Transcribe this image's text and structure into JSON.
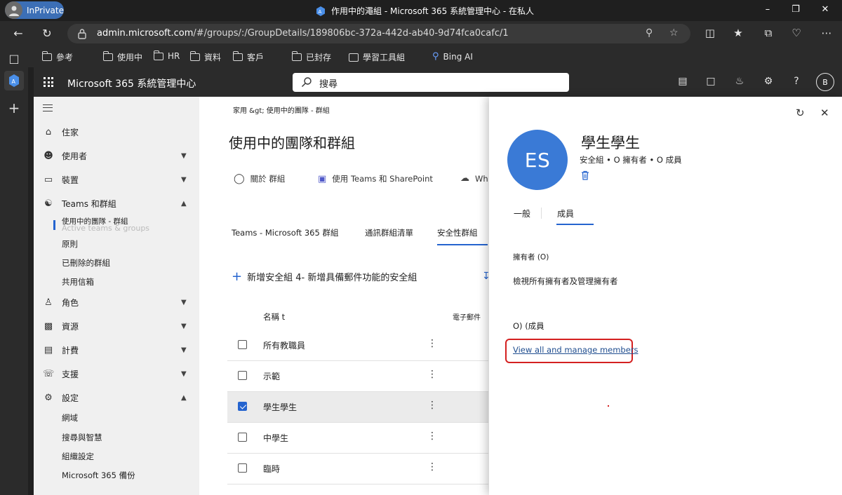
{
  "browser": {
    "inprivate_label": "InPrivate",
    "window_title": "作用中的澠組 - Microsoft 365 系統管理中心 - 在私人",
    "url_host": "admin.microsoft.com",
    "url_path": "/#/groups/:/GroupDetails/189806bc-372a-442d-ab40-9d74fca0cafc/1",
    "favorites": [
      {
        "label": "參考",
        "icon": "folder-icon"
      },
      {
        "label": "使用中",
        "icon": "folder-icon"
      },
      {
        "label": "HR",
        "icon": "folder-icon"
      },
      {
        "label": "資料",
        "icon": "folder-icon"
      },
      {
        "label": "客戶",
        "icon": "folder-icon"
      },
      {
        "label": "已封存",
        "icon": "folder-icon"
      },
      {
        "label": "學習工具組",
        "icon": "app-icon"
      },
      {
        "label": "Bing AI",
        "icon": "search-icon"
      }
    ]
  },
  "header": {
    "app_title": "Microsoft 365 系統管理中心",
    "search_placeholder": "搜尋",
    "user_initial": "B"
  },
  "nav": {
    "items": [
      {
        "label": "住家",
        "icon": "home-icon"
      },
      {
        "label": "使用者",
        "icon": "user-icon"
      },
      {
        "label": "裝置",
        "icon": "device-icon"
      },
      {
        "label": "Teams 和群組",
        "icon": "teams-icon"
      },
      {
        "label": "角色",
        "icon": "role-icon"
      },
      {
        "label": "資源",
        "icon": "resource-icon"
      },
      {
        "label": "計費",
        "icon": "billing-icon"
      },
      {
        "label": "支援",
        "icon": "support-icon"
      },
      {
        "label": "設定",
        "icon": "settings-icon"
      }
    ],
    "teams_sub": [
      "使用中的團隊 - 群組",
      "原則",
      "已刪除的群組",
      "共用信箱"
    ],
    "teams_sub_ghost": "Active teams & groups",
    "settings_sub": [
      "網域",
      "搜尋與智慧",
      "組織設定",
      "Microsoft 365 備份"
    ]
  },
  "main": {
    "breadcrumb": "家用 &gt;  使用中的團隊 - 群組",
    "title": "使用中的團隊和群組",
    "commands": [
      {
        "label": "關於 群組",
        "icon": "lightbulb-icon"
      },
      {
        "label": "使用 Teams 和 SharePoint",
        "icon": "teams-icon"
      },
      {
        "label": "Wh",
        "icon": "cloud-upload-icon"
      }
    ],
    "tabs": [
      "Teams - Microsoft 365 群組",
      "通訊群組清單",
      "安全性群組"
    ],
    "add_label": "新增安全組 4- 新增具備郵件功能的安全組",
    "columns": {
      "name": "名稱 t",
      "email": "電子郵件"
    },
    "rows": [
      {
        "name": "所有教職員",
        "selected": false
      },
      {
        "name": "示範",
        "selected": false
      },
      {
        "name": "學生學生",
        "selected": true
      },
      {
        "name": "中學生",
        "selected": false
      },
      {
        "name": "臨時",
        "selected": false
      }
    ]
  },
  "panel": {
    "avatar_initials": "ES",
    "group_name": "學生學生",
    "meta": "安全組 • O 擁有者 • O 成員",
    "tabs": [
      "一般",
      "成員"
    ],
    "owners_heading": "擁有者 (O)",
    "owners_link": "檢視所有擁有者及管理擁有者",
    "members_heading": "O) (成員",
    "members_link": "View all and manage members",
    "highlight_color": "#d42020"
  },
  "colors": {
    "accent": "#2564cf",
    "avatar": "#3a7ad6",
    "inprivate": "#3c6fb6"
  }
}
